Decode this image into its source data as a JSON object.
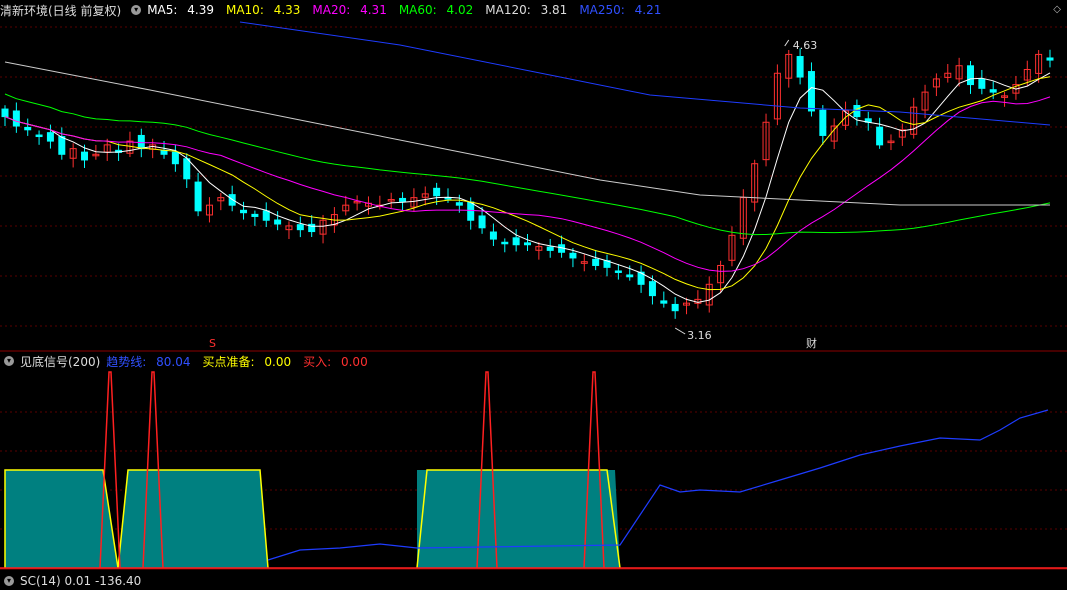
{
  "main": {
    "title": "清新环境(日线 前复权)",
    "ma": [
      {
        "label": "MA5:",
        "value": "4.39",
        "color": "#ffffff"
      },
      {
        "label": "MA10:",
        "value": "4.33",
        "color": "#ffff00"
      },
      {
        "label": "MA20:",
        "value": "4.31",
        "color": "#ff00ff"
      },
      {
        "label": "MA60:",
        "value": "4.02",
        "color": "#00ff00"
      },
      {
        "label": "MA120:",
        "value": "3.81",
        "color": "#ffffff"
      },
      {
        "label": "MA250:",
        "value": "4.21",
        "color": "#1e3cff"
      }
    ],
    "high_label": "4.63",
    "low_label": "3.16",
    "marker_s": "S",
    "marker_cai": "财",
    "collapse_icon": "diamond-icon"
  },
  "indicator": {
    "title": "见底信号(200)",
    "items": [
      {
        "label": "趋势线:",
        "value": "80.04",
        "color": "#1e3cff"
      },
      {
        "label": "买点准备:",
        "value": "0.00",
        "color": "#ffff00"
      },
      {
        "label": "买入:",
        "value": "0.00",
        "color": "#ff2020"
      }
    ]
  },
  "bottom": {
    "text": "SC(14) 0.01 -136.40"
  },
  "colors": {
    "up": "#ff3030",
    "down": "#00ffff",
    "grid": "#5a0000",
    "teal": "#008080"
  }
}
